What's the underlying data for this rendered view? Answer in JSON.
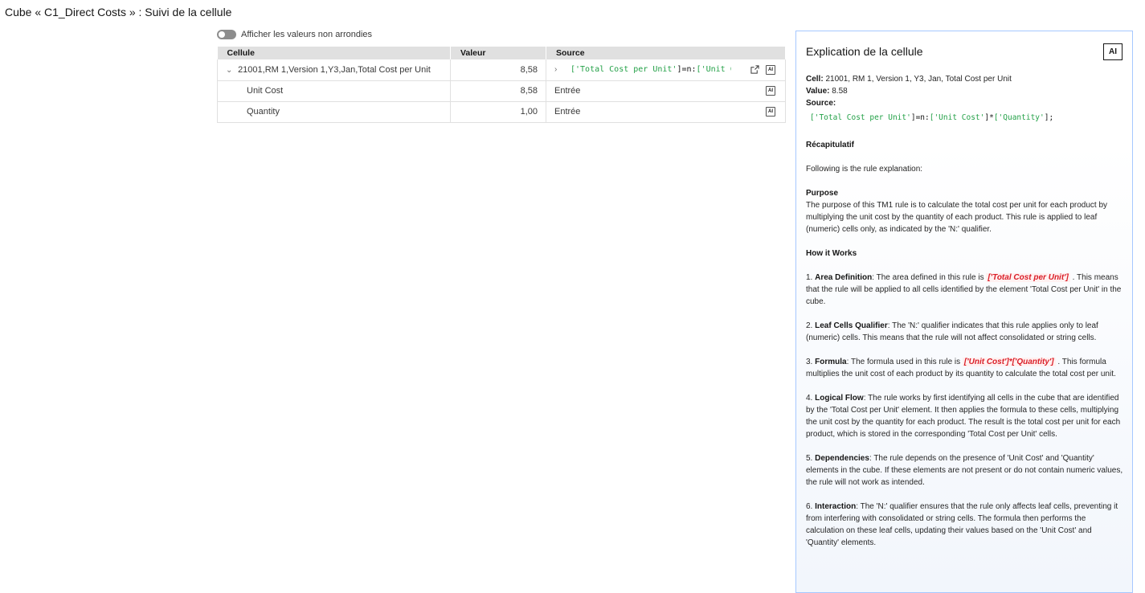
{
  "page": {
    "title": "Cube « C1_Direct Costs » : Suivi de la cellule"
  },
  "toggle": {
    "label": "Afficher les valeurs non arrondies"
  },
  "table": {
    "headers": {
      "cell": "Cellule",
      "value": "Valeur",
      "source": "Source"
    },
    "rows": [
      {
        "cell": "21001,RM 1,Version 1,Y3,Jan,Total Cost per Unit",
        "value": "8,58",
        "source_prefix": "['Total Cost per Unit'",
        "source_op": "]=n:",
        "source_suffix": "['Unit Cost'",
        "expandable": true
      },
      {
        "cell": "Unit Cost",
        "value": "8,58",
        "source": "Entrée"
      },
      {
        "cell": "Quantity",
        "value": "1,00",
        "source": "Entrée"
      }
    ]
  },
  "panel": {
    "title": "Explication de la cellule",
    "ai_label": "AI",
    "meta": {
      "cell_label": "Cell:",
      "cell_value": "21001, RM 1, Version 1, Y3, Jan, Total Cost per Unit",
      "value_label": "Value:",
      "value_value": "8.58",
      "source_label": "Source:",
      "code_a": "['Total Cost per Unit'",
      "code_op1": "]=n:",
      "code_b": "['Unit Cost'",
      "code_op2": "]*",
      "code_c": "['Quantity'",
      "code_op3": "];"
    },
    "summary_title": "Récapitulatif",
    "intro": "Following is the rule explanation:",
    "purpose_title": "Purpose",
    "purpose_text": "The purpose of this TM1 rule is to calculate the total cost per unit for each product by multiplying the unit cost by the quantity of each product. This rule is applied to leaf (numeric) cells only, as indicated by the 'N:' qualifier.",
    "how_title": "How it Works",
    "items": [
      {
        "num": "1.",
        "title": "Area Definition",
        "before": ": The area defined in this rule is ",
        "code": "['Total Cost per Unit']",
        "after": " . This means that the rule will be applied to all cells identified by the element 'Total Cost per Unit' in the cube."
      },
      {
        "num": "2.",
        "title": "Leaf Cells Qualifier",
        "before": ": The 'N:' qualifier indicates that this rule applies only to leaf (numeric) cells. This means that the rule will not affect consolidated or string cells.",
        "code": "",
        "after": ""
      },
      {
        "num": "3.",
        "title": "Formula",
        "before": ": The formula used in this rule is ",
        "code": "['Unit Cost']*['Quantity']",
        "after": " . This formula multiplies the unit cost of each product by its quantity to calculate the total cost per unit."
      },
      {
        "num": "4.",
        "title": "Logical Flow",
        "before": ": The rule works by first identifying all cells in the cube that are identified by the 'Total Cost per Unit' element. It then applies the formula to these cells, multiplying the unit cost by the quantity for each product. The result is the total cost per unit for each product, which is stored in the corresponding 'Total Cost per Unit' cells.",
        "code": "",
        "after": ""
      },
      {
        "num": "5.",
        "title": "Dependencies",
        "before": ": The rule depends on the presence of 'Unit Cost' and 'Quantity' elements in the cube. If these elements are not present or do not contain numeric values, the rule will not work as intended.",
        "code": "",
        "after": ""
      },
      {
        "num": "6.",
        "title": "Interaction",
        "before": ": The 'N:' qualifier ensures that the rule only affects leaf cells, preventing it from interfering with consolidated or string cells. The formula then performs the calculation on these leaf cells, updating their values based on the 'Unit Cost' and 'Quantity' elements.",
        "code": "",
        "after": ""
      }
    ]
  }
}
